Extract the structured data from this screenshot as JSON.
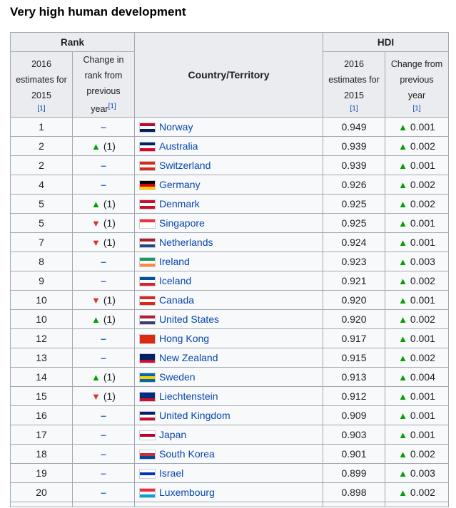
{
  "heading": "Very high human development",
  "table": {
    "rank_header": "Rank",
    "hdi_header": "HDI",
    "country_header": "Country/Territory",
    "rank_estimates": [
      "2016",
      "estimates for",
      "2015"
    ],
    "rank_change": [
      "Change in",
      "rank from",
      "previous",
      "year"
    ],
    "hdi_estimates": [
      "2016",
      "estimates for",
      "2015"
    ],
    "hdi_change": [
      "Change from",
      "previous",
      "year"
    ],
    "ref": "[1]",
    "up_symbol": "▲",
    "down_symbol": "▼",
    "dash_symbol": "–",
    "rows": [
      {
        "rank": "1",
        "change": "none",
        "change_text": "",
        "flag": "norway-flag",
        "flag_colors": [
          "#ba0c2f",
          "#fff",
          "#00205b"
        ],
        "country": "Norway",
        "hdi": "0.949",
        "hdi_change": "0.001"
      },
      {
        "rank": "2",
        "change": "up",
        "change_text": "(1)",
        "flag": "australia-flag",
        "flag_colors": [
          "#012169",
          "#fff",
          "#e4002b"
        ],
        "country": "Australia",
        "hdi": "0.939",
        "hdi_change": "0.002"
      },
      {
        "rank": "2",
        "change": "none",
        "change_text": "",
        "flag": "switzerland-flag",
        "flag_colors": [
          "#d52b1e",
          "#fff",
          "#d52b1e"
        ],
        "country": "Switzerland",
        "hdi": "0.939",
        "hdi_change": "0.001"
      },
      {
        "rank": "4",
        "change": "none",
        "change_text": "",
        "flag": "germany-flag",
        "flag_colors": [
          "#000",
          "#dd0000",
          "#ffce00"
        ],
        "country": "Germany",
        "hdi": "0.926",
        "hdi_change": "0.002"
      },
      {
        "rank": "5",
        "change": "up",
        "change_text": "(1)",
        "flag": "denmark-flag",
        "flag_colors": [
          "#c8102e",
          "#fff",
          "#c8102e"
        ],
        "country": "Denmark",
        "hdi": "0.925",
        "hdi_change": "0.002"
      },
      {
        "rank": "5",
        "change": "down",
        "change_text": "(1)",
        "flag": "singapore-flag",
        "flag_colors": [
          "#ef3340",
          "#fff",
          "#fff"
        ],
        "country": "Singapore",
        "hdi": "0.925",
        "hdi_change": "0.001"
      },
      {
        "rank": "7",
        "change": "down",
        "change_text": "(1)",
        "flag": "netherlands-flag",
        "flag_colors": [
          "#ae1c28",
          "#fff",
          "#21468b"
        ],
        "country": "Netherlands",
        "hdi": "0.924",
        "hdi_change": "0.001"
      },
      {
        "rank": "8",
        "change": "none",
        "change_text": "",
        "flag": "ireland-flag",
        "flag_colors": [
          "#169b62",
          "#fff",
          "#ff883e"
        ],
        "country": "Ireland",
        "hdi": "0.923",
        "hdi_change": "0.003"
      },
      {
        "rank": "9",
        "change": "none",
        "change_text": "",
        "flag": "iceland-flag",
        "flag_colors": [
          "#02529c",
          "#fff",
          "#dc1e35"
        ],
        "country": "Iceland",
        "hdi": "0.921",
        "hdi_change": "0.002"
      },
      {
        "rank": "10",
        "change": "down",
        "change_text": "(1)",
        "flag": "canada-flag",
        "flag_colors": [
          "#d52b1e",
          "#fff",
          "#d52b1e"
        ],
        "country": "Canada",
        "hdi": "0.920",
        "hdi_change": "0.001"
      },
      {
        "rank": "10",
        "change": "up",
        "change_text": "(1)",
        "flag": "united-states-flag",
        "flag_colors": [
          "#b22234",
          "#fff",
          "#3c3b6e"
        ],
        "country": "United States",
        "hdi": "0.920",
        "hdi_change": "0.002"
      },
      {
        "rank": "12",
        "change": "none",
        "change_text": "",
        "flag": "hong-kong-flag",
        "flag_colors": [
          "#de2910",
          "#de2910",
          "#de2910"
        ],
        "country": "Hong Kong",
        "hdi": "0.917",
        "hdi_change": "0.001"
      },
      {
        "rank": "13",
        "change": "none",
        "change_text": "",
        "flag": "new-zealand-flag",
        "flag_colors": [
          "#012169",
          "#012169",
          "#c8102e"
        ],
        "country": "New Zealand",
        "hdi": "0.915",
        "hdi_change": "0.002"
      },
      {
        "rank": "14",
        "change": "up",
        "change_text": "(1)",
        "flag": "sweden-flag",
        "flag_colors": [
          "#006aa7",
          "#fecc00",
          "#006aa7"
        ],
        "country": "Sweden",
        "hdi": "0.913",
        "hdi_change": "0.004"
      },
      {
        "rank": "15",
        "change": "down",
        "change_text": "(1)",
        "flag": "liechtenstein-flag",
        "flag_colors": [
          "#002b7f",
          "#002b7f",
          "#ce1126"
        ],
        "country": "Liechtenstein",
        "hdi": "0.912",
        "hdi_change": "0.001"
      },
      {
        "rank": "16",
        "change": "none",
        "change_text": "",
        "flag": "united-kingdom-flag",
        "flag_colors": [
          "#012169",
          "#fff",
          "#c8102e"
        ],
        "country": "United Kingdom",
        "hdi": "0.909",
        "hdi_change": "0.001"
      },
      {
        "rank": "17",
        "change": "none",
        "change_text": "",
        "flag": "japan-flag",
        "flag_colors": [
          "#fff",
          "#bc002d",
          "#fff"
        ],
        "country": "Japan",
        "hdi": "0.903",
        "hdi_change": "0.001"
      },
      {
        "rank": "18",
        "change": "none",
        "change_text": "",
        "flag": "south-korea-flag",
        "flag_colors": [
          "#fff",
          "#cd2e3a",
          "#0047a0"
        ],
        "country": "South Korea",
        "hdi": "0.901",
        "hdi_change": "0.002"
      },
      {
        "rank": "19",
        "change": "none",
        "change_text": "",
        "flag": "israel-flag",
        "flag_colors": [
          "#fff",
          "#0038b8",
          "#fff"
        ],
        "country": "Israel",
        "hdi": "0.899",
        "hdi_change": "0.003"
      },
      {
        "rank": "20",
        "change": "none",
        "change_text": "",
        "flag": "luxembourg-flag",
        "flag_colors": [
          "#ed2939",
          "#fff",
          "#00a1de"
        ],
        "country": "Luxembourg",
        "hdi": "0.898",
        "hdi_change": "0.002"
      }
    ]
  }
}
